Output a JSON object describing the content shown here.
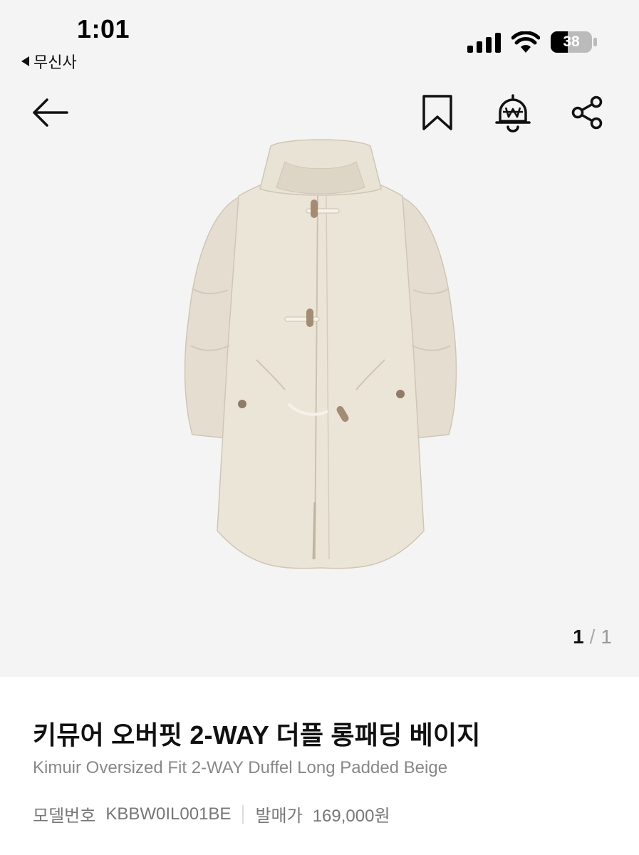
{
  "status": {
    "time": "1:01",
    "back_app": "무신사",
    "battery": "38"
  },
  "pager": {
    "current": "1",
    "separator": "/",
    "total": "1"
  },
  "product": {
    "title_ko": "키뮤어 오버핏 2-WAY 더플 롱패딩 베이지",
    "title_en": "Kimuir Oversized Fit 2-WAY Duffel Long Padded Beige",
    "model_label": "모델번호",
    "model_value": "KBBW0IL001BE",
    "price_label": "발매가",
    "price_value": "169,000원"
  },
  "icons": {
    "back": "arrow-left-icon",
    "bookmark": "bookmark-icon",
    "alert": "price-alert-bell-icon",
    "share": "share-icon"
  },
  "colors": {
    "hero_bg": "#f4f4f4",
    "coat": "#e8e2d5",
    "text_primary": "#111111",
    "text_secondary": "#888888"
  }
}
